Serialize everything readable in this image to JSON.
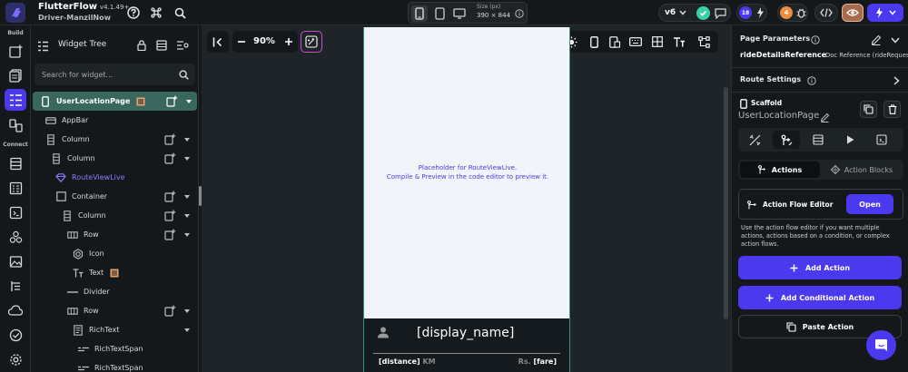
{
  "app": {
    "name": "FlutterFlow",
    "version": "v4.1.49+",
    "project": "Driver-ManzilNow"
  },
  "device": {
    "size_label": "Size (px)",
    "size_value": "390 × 844"
  },
  "topbar": {
    "version_pill": "v6",
    "notif_count": "18",
    "warn_count": "4"
  },
  "rail": {
    "build_label": "Build",
    "connect_label": "Connect"
  },
  "tree": {
    "title": "Widget Tree",
    "search_placeholder": "Search for widget...",
    "items": [
      {
        "label": "UserLocationPage"
      },
      {
        "label": "AppBar"
      },
      {
        "label": "Column"
      },
      {
        "label": "Column"
      },
      {
        "label": "RouteViewLive"
      },
      {
        "label": "Container"
      },
      {
        "label": "Column"
      },
      {
        "label": "Row"
      },
      {
        "label": "Icon"
      },
      {
        "label": "Text"
      },
      {
        "label": "Divider"
      },
      {
        "label": "Row"
      },
      {
        "label": "RichText"
      },
      {
        "label": "RichTextSpan"
      },
      {
        "label": "RichTextSpan"
      }
    ]
  },
  "canvas": {
    "zoom": "90%",
    "placeholder_line1": "Placeholder for RouteViewLive.",
    "placeholder_line2": "Compile & Preview in the code editor to preview it.",
    "display_name": "[display_name]",
    "distance": "[distance]",
    "distance_unit": "KM",
    "fare_prefix": "Rs.",
    "fare": "[fare]"
  },
  "props": {
    "page_params_title": "Page Parameters",
    "param_name": "rideDetailsReference",
    "param_type": "Doc Reference (rideReques",
    "route_settings": "Route Settings",
    "scaffold": "Scaffold",
    "page_name": "UserLocationPage",
    "seg_actions": "Actions",
    "seg_blocks": "Action Blocks",
    "flow_editor": "Action Flow Editor",
    "open_label": "Open",
    "description": "Use the action flow editor if you want multiple actions, actions based on a condition, or complex action flows.",
    "add_action": "Add Action",
    "add_conditional": "Add Conditional Action",
    "paste_action": "Paste Action"
  },
  "colors": {
    "accent": "#4b39ef",
    "selected_row": "#39675e",
    "bg": "#14181b",
    "canvas": "#1f2428",
    "phone_bg": "#f1f4f8"
  }
}
